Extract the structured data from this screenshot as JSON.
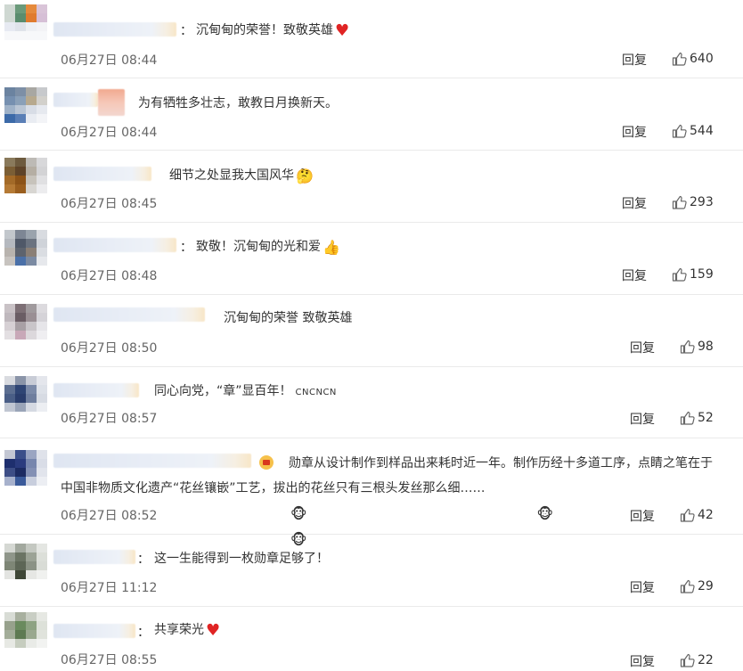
{
  "comments": [
    {
      "text": "沉甸甸的荣誉！致敬英雄",
      "emoji": "heart",
      "time": "06月27日 08:44",
      "reply": "回复",
      "likes": "640"
    },
    {
      "text": "为有牺牲多壮志，敢教日月换新天。",
      "emoji": "",
      "time": "06月27日 08:44",
      "reply": "回复",
      "likes": "544"
    },
    {
      "text": "细节之处显我大国风华",
      "emoji": "thinking-face",
      "time": "06月27日 08:45",
      "reply": "回复",
      "likes": "293"
    },
    {
      "text": "致敬！沉甸甸的光和爱",
      "emoji": "thumbs-up",
      "time": "06月27日 08:48",
      "reply": "回复",
      "likes": "159"
    },
    {
      "text": "沉甸甸的荣誉 致敬英雄",
      "emoji": "",
      "time": "06月27日 08:50",
      "reply": "回复",
      "likes": "98"
    },
    {
      "text": "同心向党，“章”显百年！",
      "tag": "CNCNCN",
      "emoji": "",
      "time": "06月27日 08:57",
      "reply": "回复",
      "likes": "52"
    },
    {
      "text": "勋章从设计制作到样品出来耗时近一年。制作历经十多道工序，点睛之笔在于中国非物质文化遗产“花丝镶嵌”工艺，拔出的花丝只有三根头发丝那么细……",
      "emoji": "monkey-face",
      "time": "06月27日 08:52",
      "reply": "回复",
      "likes": "42"
    },
    {
      "text": "这一生能得到一枚勋章足够了！",
      "emoji": "",
      "time": "06月27日 11:12",
      "reply": "回复",
      "likes": "29"
    },
    {
      "text": "共享荣光",
      "emoji": "heart",
      "time": "06月27日 08:55",
      "reply": "回复",
      "likes": "22"
    }
  ],
  "colon": "：",
  "colors": {
    "text": "#333333",
    "time": "#666666",
    "divider": "#eaeaea",
    "heart": "#e02424"
  }
}
